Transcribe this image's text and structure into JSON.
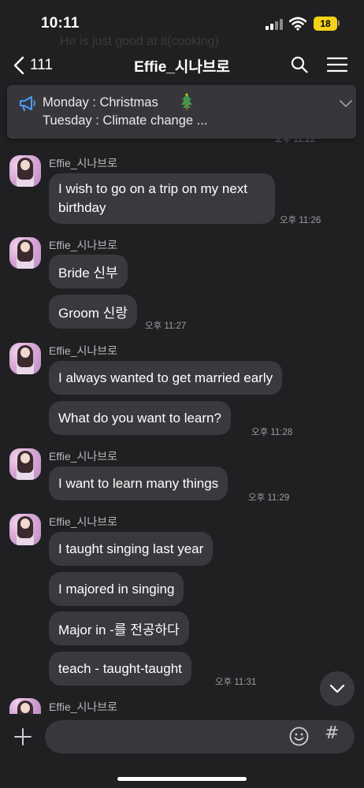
{
  "status_bar": {
    "time": "10:11",
    "battery": "18"
  },
  "header": {
    "back_count": "111",
    "title": "Effie_시나브로"
  },
  "background_ghost": {
    "line1": "He is just good at it(cooking)"
  },
  "notice": {
    "line1": "Monday : Christmas",
    "line2": "Tuesday : Climate change ..."
  },
  "top_partial": {
    "time": "오후 11:22"
  },
  "messages": [
    {
      "sender": "Effie_시나브로",
      "bubbles": [
        "I wish to go on a trip on my next birthday"
      ],
      "time": "오후 11:26"
    },
    {
      "sender": "Effie_시나브로",
      "bubbles": [
        "Bride 신부",
        "Groom 신랑"
      ],
      "time": "오후 11:27"
    },
    {
      "sender": "Effie_시나브로",
      "bubbles": [
        "I always wanted to get married early",
        "What do you want to learn?"
      ],
      "time": "오후 11:28"
    },
    {
      "sender": "Effie_시나브로",
      "bubbles": [
        "I want to learn many things"
      ],
      "time": "오후 11:29"
    },
    {
      "sender": "Effie_시나브로",
      "bubbles": [
        "I taught singing last year",
        "I majored in singing",
        "Major in -를 전공하다",
        "teach - taught-taught"
      ],
      "time": "오후 11:31"
    },
    {
      "sender": "Effie_시나브로",
      "bubbles": [],
      "time": ""
    }
  ],
  "input": {
    "placeholder": ""
  },
  "colors": {
    "background": "#202022",
    "bubble": "#3a3a3e",
    "notice": "#37373b",
    "battery": "#f5d21a"
  },
  "icons": [
    "back-chevron-icon",
    "search-icon",
    "menu-icon",
    "megaphone-icon",
    "christmas-tree-icon",
    "chevron-down-icon",
    "plus-icon",
    "emoji-icon",
    "hash-icon"
  ]
}
